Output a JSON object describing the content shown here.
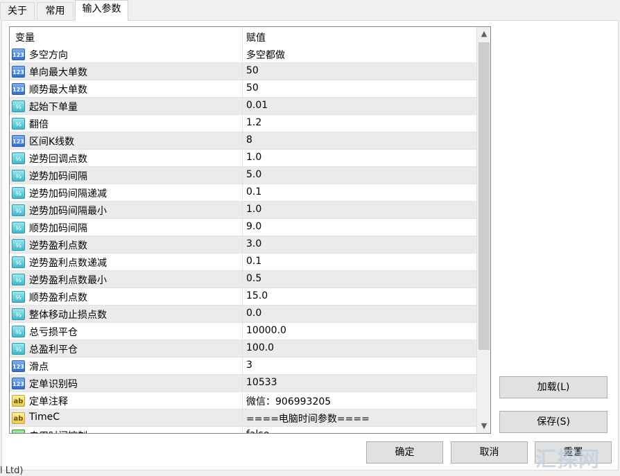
{
  "tabs": [
    {
      "label": "关于"
    },
    {
      "label": "常用"
    },
    {
      "label": "输入参数"
    }
  ],
  "grid": {
    "col_name": "变量",
    "col_value": "赋值",
    "rows": [
      {
        "icon": "int",
        "icon_label": "123",
        "name": "多空方向",
        "value": "多空都做"
      },
      {
        "icon": "int",
        "icon_label": "123",
        "name": "单向最大单数",
        "value": "50"
      },
      {
        "icon": "int",
        "icon_label": "123",
        "name": "顺势最大单数",
        "value": "50"
      },
      {
        "icon": "dbl",
        "icon_label": "½",
        "name": "起始下单量",
        "value": "0.01"
      },
      {
        "icon": "dbl",
        "icon_label": "½",
        "name": "翻倍",
        "value": "1.2"
      },
      {
        "icon": "int",
        "icon_label": "123",
        "name": "区间K线数",
        "value": "8"
      },
      {
        "icon": "dbl",
        "icon_label": "½",
        "name": "逆势回调点数",
        "value": "1.0"
      },
      {
        "icon": "dbl",
        "icon_label": "½",
        "name": "逆势加码间隔",
        "value": "5.0"
      },
      {
        "icon": "dbl",
        "icon_label": "½",
        "name": "逆势加码间隔递减",
        "value": "0.1"
      },
      {
        "icon": "dbl",
        "icon_label": "½",
        "name": "逆势加码间隔最小",
        "value": "1.0"
      },
      {
        "icon": "dbl",
        "icon_label": "½",
        "name": "顺势加码间隔",
        "value": "9.0"
      },
      {
        "icon": "dbl",
        "icon_label": "½",
        "name": "逆势盈利点数",
        "value": "3.0"
      },
      {
        "icon": "dbl",
        "icon_label": "½",
        "name": "逆势盈利点数递减",
        "value": "0.1"
      },
      {
        "icon": "dbl",
        "icon_label": "½",
        "name": "逆势盈利点数最小",
        "value": "0.5"
      },
      {
        "icon": "dbl",
        "icon_label": "½",
        "name": "顺势盈利点数",
        "value": "15.0"
      },
      {
        "icon": "dbl",
        "icon_label": "½",
        "name": "整体移动止损点数",
        "value": "0.0"
      },
      {
        "icon": "dbl",
        "icon_label": "½",
        "name": "总亏损平仓",
        "value": "10000.0"
      },
      {
        "icon": "dbl",
        "icon_label": "½",
        "name": "总盈利平仓",
        "value": "100.0"
      },
      {
        "icon": "int",
        "icon_label": "123",
        "name": "滑点",
        "value": "3"
      },
      {
        "icon": "int",
        "icon_label": "123",
        "name": "定单识别码",
        "value": "10533"
      },
      {
        "icon": "str",
        "icon_label": "ab",
        "name": "定单注释",
        "value": "微信：906993205"
      },
      {
        "icon": "str",
        "icon_label": "ab",
        "name": "TimeC",
        "value": "====电脑时间参数===="
      },
      {
        "icon": "bool",
        "icon_label": "✓",
        "name": "启用时间控制",
        "value": "false"
      }
    ]
  },
  "buttons": {
    "load": "加载(L)",
    "save": "保存(S)",
    "ok": "确定",
    "cancel": "取消",
    "reset": "重置"
  },
  "watermark": "汇探网",
  "footer": "l Ltd)"
}
